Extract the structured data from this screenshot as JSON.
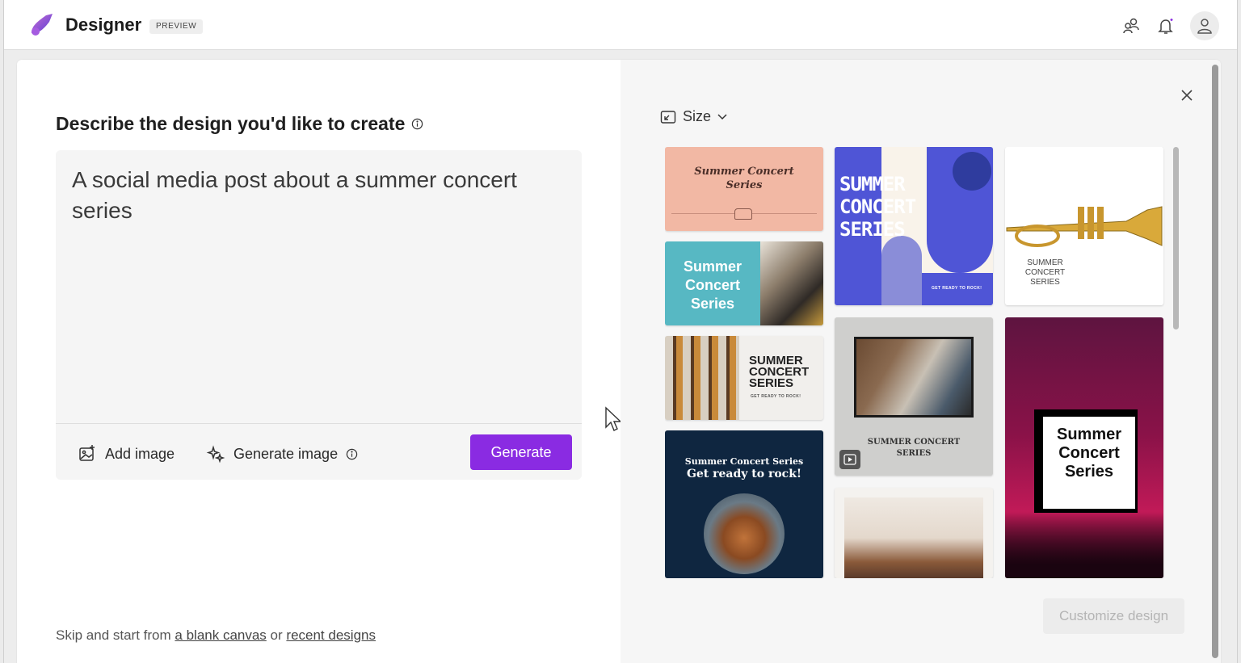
{
  "app": {
    "brand": "Designer",
    "badge": "PREVIEW"
  },
  "prompt_panel": {
    "heading": "Describe the design you'd like to create",
    "prompt_text": "A social media post about a summer concert series",
    "add_image_label": "Add image",
    "generate_image_label": "Generate image",
    "generate_label": "Generate"
  },
  "footer": {
    "skip_prefix": "Skip and start from",
    "blank_canvas_link": "a blank canvas",
    "or_text": "or",
    "recent_designs_link": "recent designs"
  },
  "results_panel": {
    "size_label": "Size",
    "customize_label": "Customize design",
    "designs": [
      {
        "lines": [
          "Summer Concert",
          "Series"
        ]
      },
      {
        "lines": [
          "Summer",
          "Concert",
          "Series"
        ]
      },
      {
        "lines": [
          "SUMMER",
          "CONCERT",
          "SERIES"
        ],
        "tagline": "GET READY TO ROCK!"
      },
      {
        "lines": [
          "Summer Concert Series",
          "Get ready to rock!"
        ]
      },
      {
        "lines": [
          "SUMMER",
          "CONCERT",
          "SERIES"
        ],
        "tagline": "GET READY TO ROCK!"
      },
      {
        "lines": [
          "SUMMER CONCERT",
          "SERIES"
        ]
      },
      {
        "lines": [
          "SUMMER",
          "CONCERT",
          "SERIES"
        ]
      },
      {
        "lines": [
          "Summer",
          "Concert",
          "Series"
        ]
      }
    ]
  },
  "colors": {
    "accent": "#8a2be2",
    "peach": "#f2b8a4",
    "teal": "#57b8c3",
    "cobalt": "#4f55d6",
    "navy": "#0f2640",
    "magenta": "#a8124f"
  }
}
